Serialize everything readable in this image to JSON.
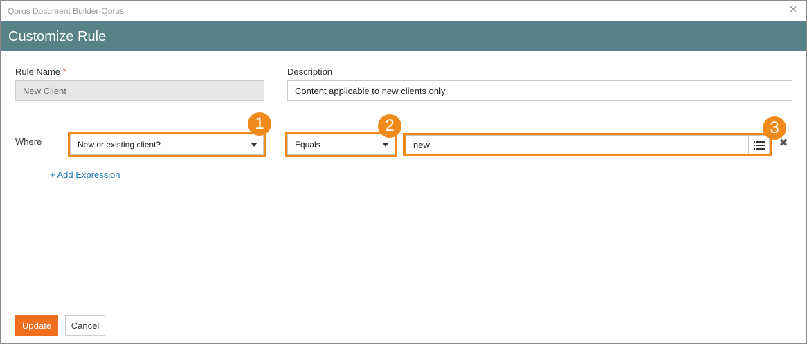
{
  "window": {
    "title": "Qorus Document Builder-Qorus",
    "close_glyph": "✕"
  },
  "header": {
    "title": "Customize Rule"
  },
  "form": {
    "rule_name": {
      "label": "Rule Name",
      "required_mark": "*",
      "value": "New Client"
    },
    "description": {
      "label": "Description",
      "value": "Content applicable to new clients only"
    }
  },
  "expression": {
    "where_label": "Where",
    "field_select": {
      "value": "New or existing client?"
    },
    "operator_select": {
      "value": "Equals"
    },
    "value_input": {
      "value": "new"
    },
    "add_expression_label": "+ Add Expression"
  },
  "callouts": [
    "1",
    "2",
    "3"
  ],
  "footer": {
    "update_label": "Update",
    "cancel_label": "Cancel"
  },
  "colors": {
    "header_bg": "#578287",
    "highlight": "#ef8a1b",
    "primary_button": "#ef6e1e",
    "link": "#1a7ab8"
  }
}
